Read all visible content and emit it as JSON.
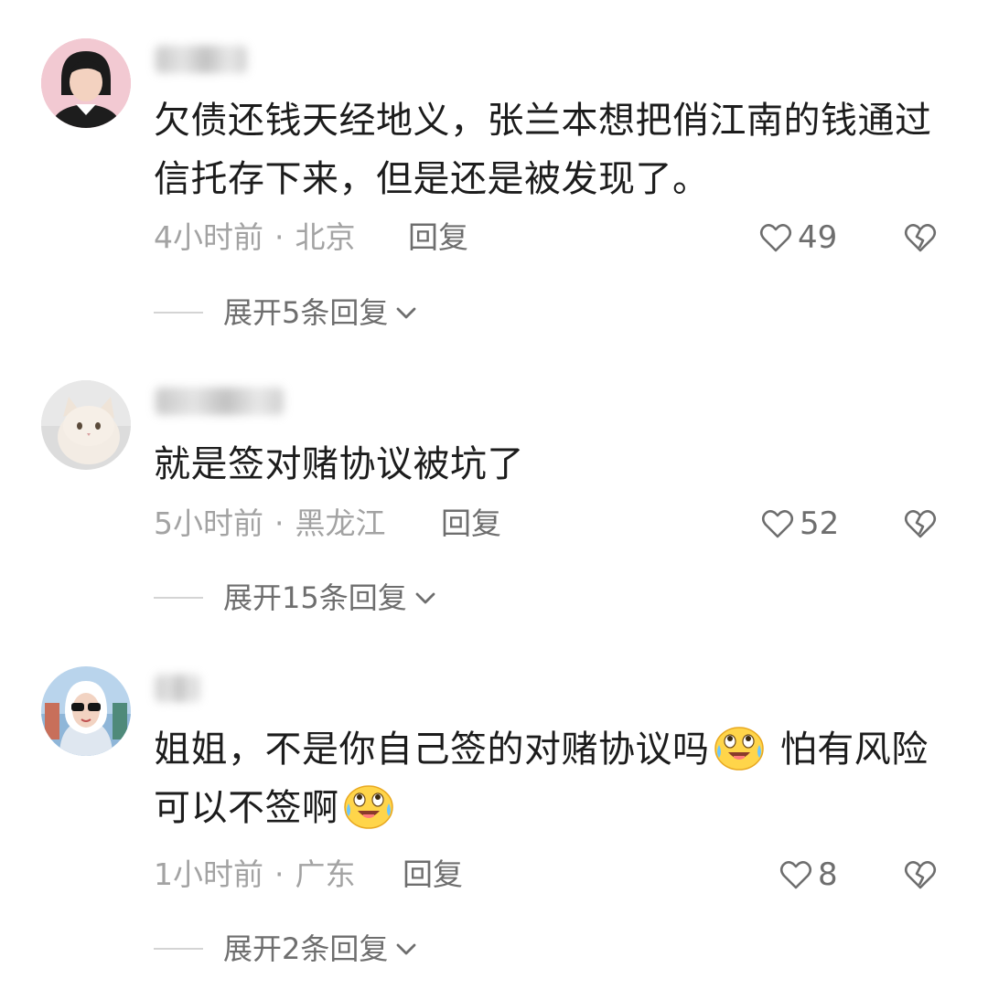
{
  "comments": [
    {
      "username": "",
      "text_lines": [
        "欠债还钱天经地义，张兰本想把俏江南的钱通过",
        "信托存下来，但是还是被发现了。"
      ],
      "time": "4小时前",
      "location": "北京",
      "reply_label": "回复",
      "likes": "49",
      "expand_label": "展开5条回复"
    },
    {
      "username": "",
      "text_lines": [
        "就是签对赌协议被坑了"
      ],
      "time": "5小时前",
      "location": "黑龙江",
      "reply_label": "回复",
      "likes": "52",
      "expand_label": "展开15条回复"
    },
    {
      "username": "",
      "text_line1_a": "姐姐，不是你自己签的对赌协议吗",
      "text_line1_b": " 怕有风险",
      "text_line2": "可以不签啊",
      "emoji_name": "crying-laughing-emoji",
      "time": "1小时前",
      "location": "广东",
      "reply_label": "回复",
      "likes": "8",
      "expand_label": "展开2条回复"
    }
  ],
  "separator": "·",
  "colors": {
    "text": "#1c1c1c",
    "meta": "#a3a3a3",
    "action": "#6e6e6e",
    "divider": "#d4d4d4"
  }
}
